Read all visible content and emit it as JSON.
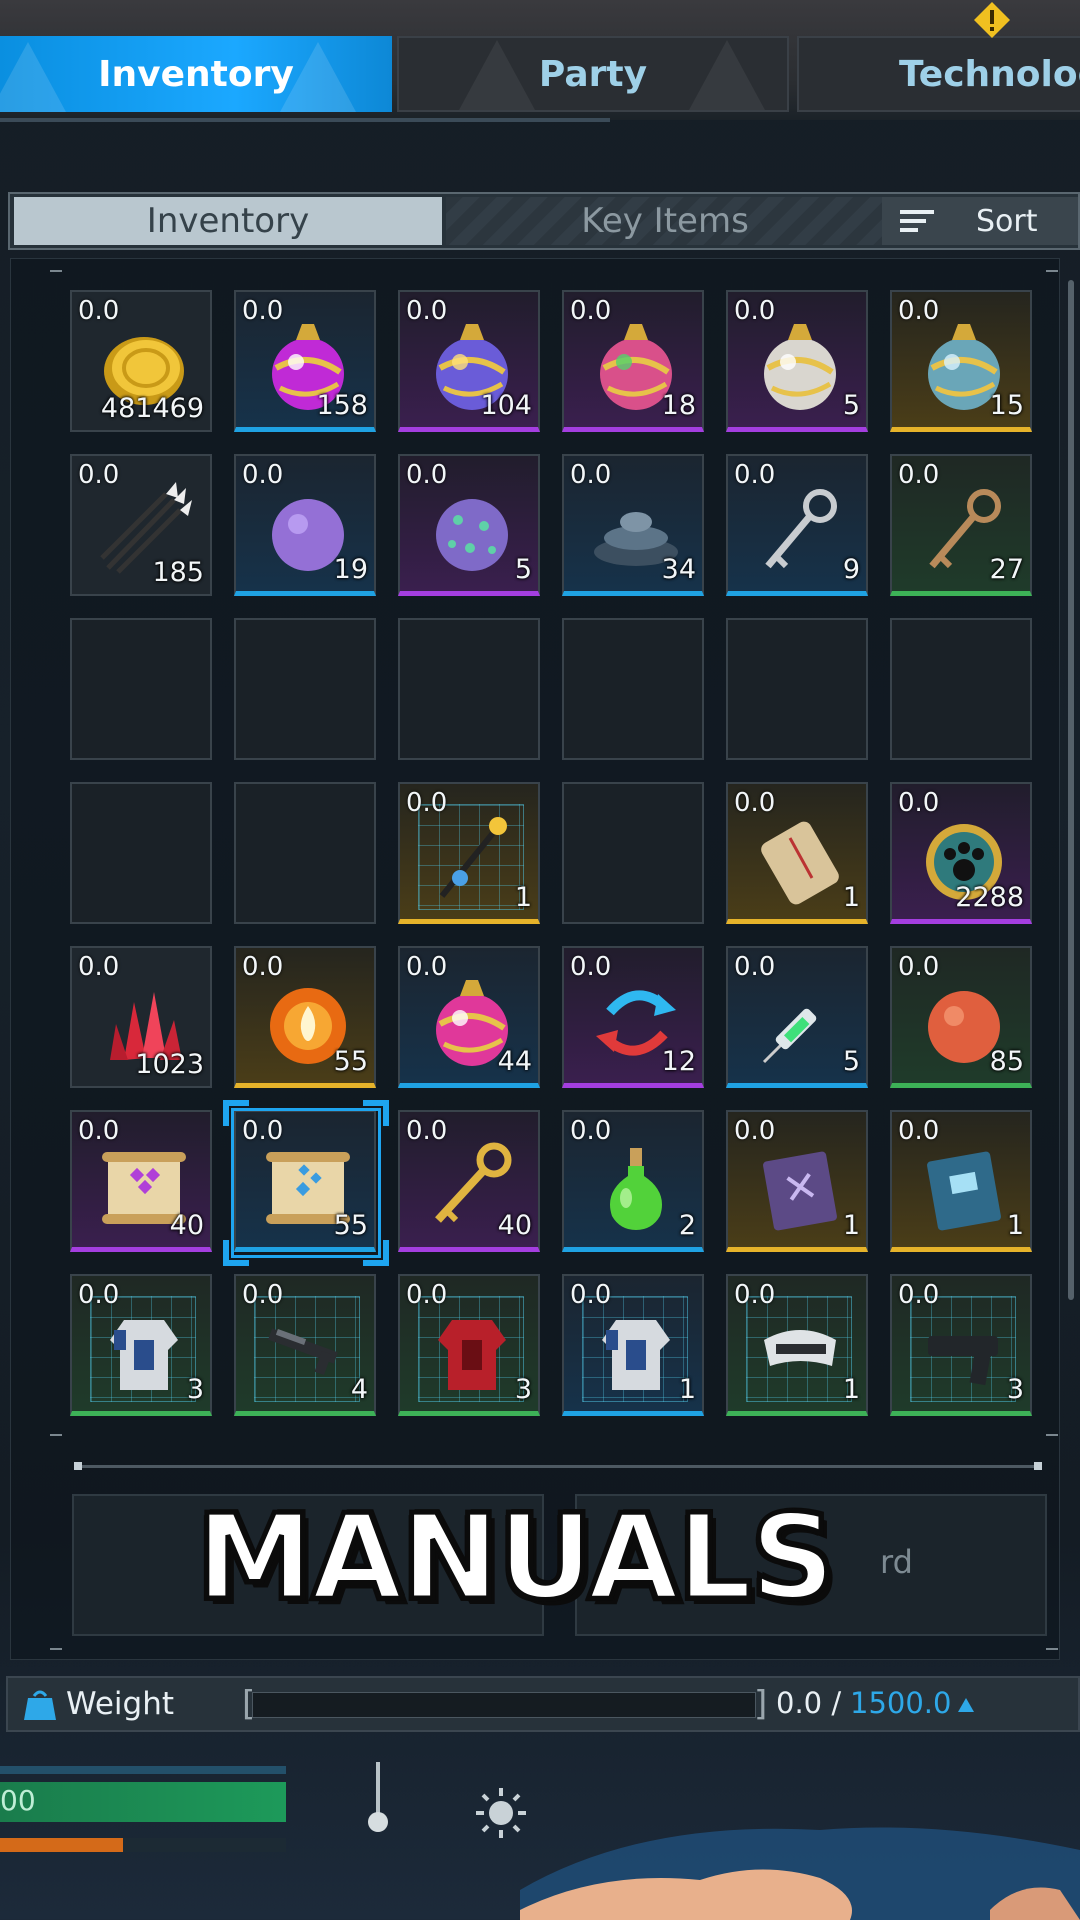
{
  "top_tabs": [
    {
      "label": "Inventory",
      "active": true
    },
    {
      "label": "Party",
      "active": false
    },
    {
      "label": "Technology",
      "active": false
    }
  ],
  "sub_tabs": {
    "inventory": "Inventory",
    "key_items": "Key Items",
    "sort": "Sort"
  },
  "slots": [
    {
      "weight": "0.0",
      "count": "481469",
      "rarity": "none",
      "icon": "gold-coin-icon"
    },
    {
      "weight": "0.0",
      "count": "158",
      "rarity": "blue",
      "icon": "pal-sphere-magenta-icon"
    },
    {
      "weight": "0.0",
      "count": "104",
      "rarity": "purple",
      "icon": "pal-sphere-rainbow-icon"
    },
    {
      "weight": "0.0",
      "count": "18",
      "rarity": "purple",
      "icon": "pal-sphere-multicolor-icon"
    },
    {
      "weight": "0.0",
      "count": "5",
      "rarity": "purple",
      "icon": "pal-sphere-white-icon"
    },
    {
      "weight": "0.0",
      "count": "15",
      "rarity": "gold",
      "icon": "pal-sphere-ice-icon"
    },
    {
      "weight": "0.0",
      "count": "185",
      "rarity": "none",
      "icon": "arrows-icon"
    },
    {
      "weight": "0.0",
      "count": "19",
      "rarity": "blue",
      "icon": "purple-ball-icon"
    },
    {
      "weight": "0.0",
      "count": "5",
      "rarity": "purple",
      "icon": "spotted-ball-icon"
    },
    {
      "weight": "0.0",
      "count": "34",
      "rarity": "blue",
      "icon": "landmine-icon"
    },
    {
      "weight": "0.0",
      "count": "9",
      "rarity": "blue",
      "icon": "silver-key-icon"
    },
    {
      "weight": "0.0",
      "count": "27",
      "rarity": "green",
      "icon": "bronze-key-icon"
    },
    {
      "empty": true
    },
    {
      "empty": true
    },
    {
      "empty": true
    },
    {
      "empty": true
    },
    {
      "empty": true
    },
    {
      "empty": true
    },
    {
      "empty": true
    },
    {
      "empty": true
    },
    {
      "weight": "0.0",
      "count": "1",
      "rarity": "gold",
      "icon": "blueprint-staff-icon",
      "blueprint": true
    },
    {
      "empty": true
    },
    {
      "weight": "0.0",
      "count": "1",
      "rarity": "gold",
      "icon": "scroll-icon"
    },
    {
      "weight": "0.0",
      "count": "2288",
      "rarity": "purple",
      "icon": "paw-medal-icon"
    },
    {
      "weight": "0.0",
      "count": "1023",
      "rarity": "none",
      "icon": "red-crystal-icon"
    },
    {
      "weight": "0.0",
      "count": "55",
      "rarity": "gold",
      "icon": "fire-orb-icon"
    },
    {
      "weight": "0.0",
      "count": "44",
      "rarity": "blue",
      "icon": "pal-sphere-pink-icon"
    },
    {
      "weight": "0.0",
      "count": "12",
      "rarity": "purple",
      "icon": "swap-arrows-icon"
    },
    {
      "weight": "0.0",
      "count": "5",
      "rarity": "blue",
      "icon": "syringe-icon"
    },
    {
      "weight": "0.0",
      "count": "85",
      "rarity": "green",
      "icon": "orange-ball-icon"
    },
    {
      "weight": "0.0",
      "count": "40",
      "rarity": "purple",
      "icon": "purple-manual-scroll-icon"
    },
    {
      "weight": "0.0",
      "count": "55",
      "rarity": "blue",
      "icon": "blue-manual-scroll-icon",
      "selected": true
    },
    {
      "weight": "0.0",
      "count": "40",
      "rarity": "purple",
      "icon": "gold-key-icon"
    },
    {
      "weight": "0.0",
      "count": "2",
      "rarity": "blue",
      "icon": "green-potion-icon"
    },
    {
      "weight": "0.0",
      "count": "1",
      "rarity": "gold",
      "icon": "purple-book-icon"
    },
    {
      "weight": "0.0",
      "count": "1",
      "rarity": "gold",
      "icon": "blue-book-icon"
    },
    {
      "weight": "0.0",
      "count": "3",
      "rarity": "green",
      "icon": "blueprint-armor-white-icon",
      "blueprint": true
    },
    {
      "weight": "0.0",
      "count": "4",
      "rarity": "green",
      "icon": "blueprint-rifle-icon",
      "blueprint": true
    },
    {
      "weight": "0.0",
      "count": "3",
      "rarity": "green",
      "icon": "blueprint-armor-red-icon",
      "blueprint": true
    },
    {
      "weight": "0.0",
      "count": "1",
      "rarity": "blue",
      "icon": "blueprint-armor-white-icon",
      "blueprint": true
    },
    {
      "weight": "0.0",
      "count": "1",
      "rarity": "green",
      "icon": "blueprint-helmet-icon",
      "blueprint": true
    },
    {
      "weight": "0.0",
      "count": "3",
      "rarity": "green",
      "icon": "blueprint-pistol-icon",
      "blueprint": true
    }
  ],
  "detail": {
    "right_partial_text": "rd"
  },
  "overlay_caption": "MANUALS",
  "weight": {
    "label": "Weight",
    "current": "0.0 /",
    "max": "1500.0"
  },
  "hud": {
    "green_bar_text": "00",
    "stamina_fraction": 0.43
  },
  "colors": {
    "accent_blue": "#1ba8ff",
    "rarity_blue": "#1fa2e3",
    "rarity_purple": "#a43ee0",
    "rarity_gold": "#e6b32a",
    "rarity_green": "#3db257"
  }
}
